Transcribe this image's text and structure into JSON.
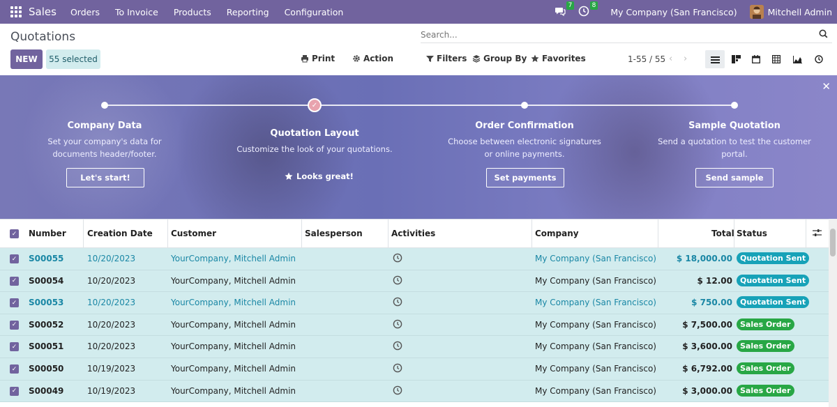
{
  "topbar": {
    "brand": "Sales",
    "menu": [
      "Orders",
      "To Invoice",
      "Products",
      "Reporting",
      "Configuration"
    ],
    "messages_count": "7",
    "activities_count": "8",
    "company": "My Company (San Francisco)",
    "user": "Mitchell Admin"
  },
  "control": {
    "title": "Quotations",
    "new_label": "NEW",
    "selected_label": "55 selected",
    "print_label": "Print",
    "action_label": "Action",
    "search_placeholder": "Search...",
    "filters_label": "Filters",
    "groupby_label": "Group By",
    "favorites_label": "Favorites",
    "pager": "1-55 / 55"
  },
  "banner": {
    "steps": [
      {
        "title": "Company Data",
        "desc": "Set your company's data for documents header/footer.",
        "button": "Let's start!"
      },
      {
        "title": "Quotation Layout",
        "desc": "Customize the look of your quotations.",
        "done": "Looks great!"
      },
      {
        "title": "Order Confirmation",
        "desc": "Choose between electronic signatures or online payments.",
        "button": "Set payments"
      },
      {
        "title": "Sample Quotation",
        "desc": "Send a quotation to test the customer portal.",
        "button": "Send sample"
      }
    ]
  },
  "table": {
    "headers": {
      "number": "Number",
      "creation_date": "Creation Date",
      "customer": "Customer",
      "salesperson": "Salesperson",
      "activities": "Activities",
      "company": "Company",
      "total": "Total",
      "status": "Status"
    },
    "rows": [
      {
        "number": "S00055",
        "date": "10/20/2023",
        "customer": "YourCompany, Mitchell Admin",
        "company": "My Company (San Francisco)",
        "total": "$ 18,000.00",
        "status": "Quotation Sent",
        "highlight": true
      },
      {
        "number": "S00054",
        "date": "10/20/2023",
        "customer": "YourCompany, Mitchell Admin",
        "company": "My Company (San Francisco)",
        "total": "$ 12.00",
        "status": "Quotation Sent",
        "highlight": false
      },
      {
        "number": "S00053",
        "date": "10/20/2023",
        "customer": "YourCompany, Mitchell Admin",
        "company": "My Company (San Francisco)",
        "total": "$ 750.00",
        "status": "Quotation Sent",
        "highlight": true
      },
      {
        "number": "S00052",
        "date": "10/20/2023",
        "customer": "YourCompany, Mitchell Admin",
        "company": "My Company (San Francisco)",
        "total": "$ 7,500.00",
        "status": "Sales Order",
        "highlight": false
      },
      {
        "number": "S00051",
        "date": "10/20/2023",
        "customer": "YourCompany, Mitchell Admin",
        "company": "My Company (San Francisco)",
        "total": "$ 3,600.00",
        "status": "Sales Order",
        "highlight": false
      },
      {
        "number": "S00050",
        "date": "10/19/2023",
        "customer": "YourCompany, Mitchell Admin",
        "company": "My Company (San Francisco)",
        "total": "$ 6,792.00",
        "status": "Sales Order",
        "highlight": false
      },
      {
        "number": "S00049",
        "date": "10/19/2023",
        "customer": "YourCompany, Mitchell Admin",
        "company": "My Company (San Francisco)",
        "total": "$ 3,000.00",
        "status": "Sales Order",
        "highlight": false
      }
    ]
  },
  "colors": {
    "brand": "#71639e",
    "selection": "#d2ecee",
    "link": "#1a87a5",
    "status_sent": "#17a2b8",
    "status_order": "#28a745"
  }
}
